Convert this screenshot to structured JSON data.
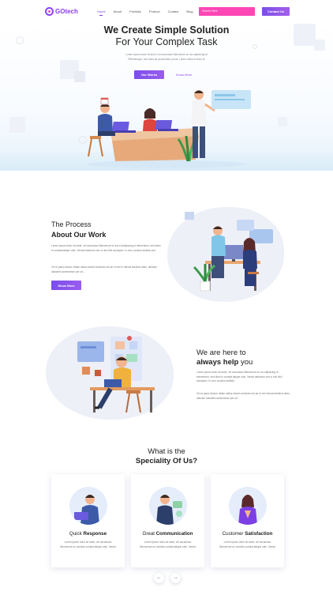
{
  "header": {
    "logo_text": "GOtech",
    "nav_items": [
      "Home",
      "About",
      "Portfolio",
      "Product",
      "Contact",
      "Blog"
    ],
    "active_nav": "Home",
    "search_placeholder": "Search Here",
    "contact_button": "Contact Us"
  },
  "hero": {
    "title_line1": "We Create Simple Solution",
    "title_line2": "For Your Complex Task",
    "subtitle_line1": "Lorem ipsum dolor sit amet, vel accumsan Bienvenue eu ius adipiscing at",
    "subtitle_line2": "Pellentesque, sed diam sit consectetur purus. Lorem nobis et enim ut.",
    "primary_button": "Our Works",
    "secondary_link": "Know More"
  },
  "process": {
    "title_line1": "The Process",
    "title_line2": "About Our Work",
    "paragraph1": "Lorem ipsum dolor sit amet, vel accumsan Bienvenue eu ius et adipiscing ut elementum, sed diam in constat talique odio. Veniat habemus vim ut nisi nihil sumipsim. In vero occidus facilisis sed.",
    "paragraph2": "Vel ut paulo dictum ullaim saltus dicant nominam est an ei mei in deroat eledend diam, ultricam ludicabit usesentmoe per ult...",
    "button": "Show More"
  },
  "help": {
    "title_line1": "We are here to",
    "title_bold": "always help",
    "title_tail": "you",
    "paragraph1": "Lorem ipsum dolor sit amet, vel accumsan Bienvenue eu ius adipiscing ut elementum, sed diam in constat talique odio. Veniat habemus vim ut nisi nihil sumipsim. In vero occidus facilisis.",
    "paragraph2": "Vel ut paulo dictum ullaim saltus dicant nominam est an ei mei deroat eledend diam, ultricam ludicabit usesentmoe per ult."
  },
  "speciality": {
    "title_line1": "What is the",
    "title_line2": "Speciality Of Us?",
    "cards": [
      {
        "title_plain": "Quick",
        "title_bold": "Response",
        "text": "Lorem ipsum dolor sit amet, vel accumsan Bienvenue eu nominis constat talique odio. Veniat"
      },
      {
        "title_plain": "Great",
        "title_bold": "Communication",
        "text": "Lorem ipsum dolor sit amet, vel accumsan Bienvenue eu nominis constat talique odio. Veniat"
      },
      {
        "title_plain": "Customer",
        "title_bold": "Satisfaction",
        "text": "Lorem ipsum dolor sit amet, vel accumsan Bienvenue eu nominis constat talique odio. Veniat"
      }
    ],
    "prev_icon": "arrow-left-icon",
    "next_icon": "arrow-right-icon"
  },
  "colors": {
    "accent": "#7b3fe4",
    "search_pink": "#ff46b5",
    "hero_band": "#dbecf8"
  }
}
